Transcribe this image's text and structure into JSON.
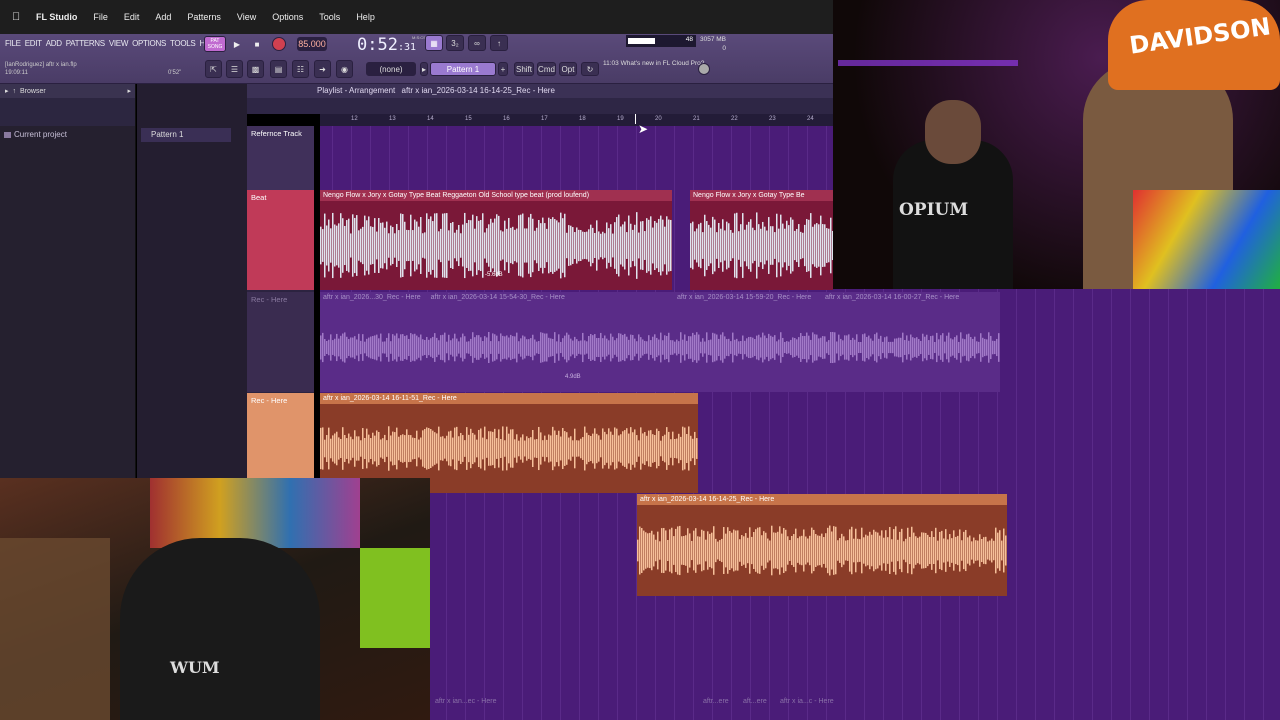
{
  "macbar": {
    "app": "FL Studio",
    "menus": [
      "File",
      "Edit",
      "Add",
      "Patterns",
      "View",
      "Options",
      "Tools",
      "Help"
    ]
  },
  "fl": {
    "menus": [
      "FILE",
      "EDIT",
      "ADD",
      "PATTERNS",
      "VIEW",
      "OPTIONS",
      "TOOLS",
      "HELP"
    ],
    "mode": "PAT",
    "mode2": "SONG",
    "bpm": "85.000",
    "time": "0:52",
    "time_frac": ":31",
    "time_label": "M:S:CS",
    "cpu_val": "48",
    "cpu_fraction": 0.45,
    "mem": "3057 MB",
    "mem2": "0",
    "file_user": "[IanRodriguez]",
    "file_name": "aftr x ian.flp",
    "file_time": "19:09:11",
    "file_pos": "0'52\"",
    "snap": "(none)",
    "pattern": "Pattern 1",
    "keys": [
      "Shift",
      "Cmd",
      "Opt"
    ],
    "news_time": "11:03",
    "news_text": "What's new in FL Cloud Pro?"
  },
  "browser": {
    "title": "Browser",
    "item": "Current project"
  },
  "patterns": {
    "item": "Pattern 1"
  },
  "playlist": {
    "title": "Playlist - Arrangement",
    "path": "aftr x ian_2026-03-14 16-14-25_Rec - Here"
  },
  "ruler": [
    "12",
    "13",
    "14",
    "15",
    "16",
    "17",
    "18",
    "19",
    "20",
    "21",
    "22",
    "23",
    "24"
  ],
  "tracks": {
    "ref": "Refernce Track",
    "beat": "Beat",
    "rec_faded": "Rec - Here",
    "rec": "Rec - Here"
  },
  "clips": {
    "beat1": "Nengo Flow x Jory x Gotay Type Beat  Reggaeton Old School type beat (prod loufend)",
    "beat2": "Nengo Flow x Jory x Gotay Type Be",
    "beat_gain": "-5.6dB",
    "ghost1": "aftr x ian_2026...30_Rec - Here",
    "ghost2": "aftr x ian_2026-03-14 15-54-30_Rec - Here",
    "ghost3": "aftr x ian_2026-03-14 15-59-20_Rec - Here",
    "ghost4": "aftr x ian_2026-03-14 16-00-27_Rec - Here",
    "ghost_gain": "4.9dB",
    "rec1": "aftr x ian_2026-03-14 16-11-51_Rec - Here",
    "rec2": "aftr x ian_2026-03-14 16-14-25_Rec - Here",
    "bottom1": "aftr x ian...ec - Here",
    "bottom2": "aftr...ere",
    "bottom3": "aft...ere",
    "bottom4": "aftr x ia...c - Here"
  },
  "cam": {
    "cap": "DAVIDSON",
    "shirt": "OPIUM",
    "shirt2": "WUM"
  },
  "colors": {
    "beat": "#b03050",
    "rec": "#c7744a",
    "track_bg": "#4a1c78"
  }
}
